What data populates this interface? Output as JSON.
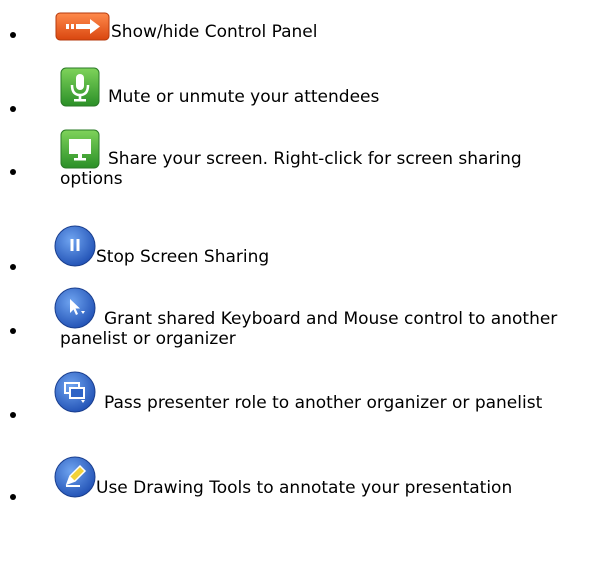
{
  "items": [
    {
      "icon": "show-hide-panel-icon",
      "text": "Show/hide Control Panel"
    },
    {
      "icon": "microphone-icon",
      "text": "Mute or unmute your attendees"
    },
    {
      "icon": "screen-share-icon",
      "text": "Share your screen. Right-click for screen sharing options"
    },
    {
      "icon": "pause-icon",
      "text": "Stop Screen Sharing"
    },
    {
      "icon": "mouse-pointer-icon",
      "text": "Grant shared Keyboard and Mouse control to another panelist or organizer"
    },
    {
      "icon": "presenter-icon",
      "text": "Pass presenter role to another organizer or panelist"
    },
    {
      "icon": "pencil-icon",
      "text": "Use Drawing Tools to annotate your presentation"
    }
  ],
  "colors": {
    "orange": "#e8561a",
    "green": "#3aa33a",
    "blue": "#2e62c4"
  }
}
